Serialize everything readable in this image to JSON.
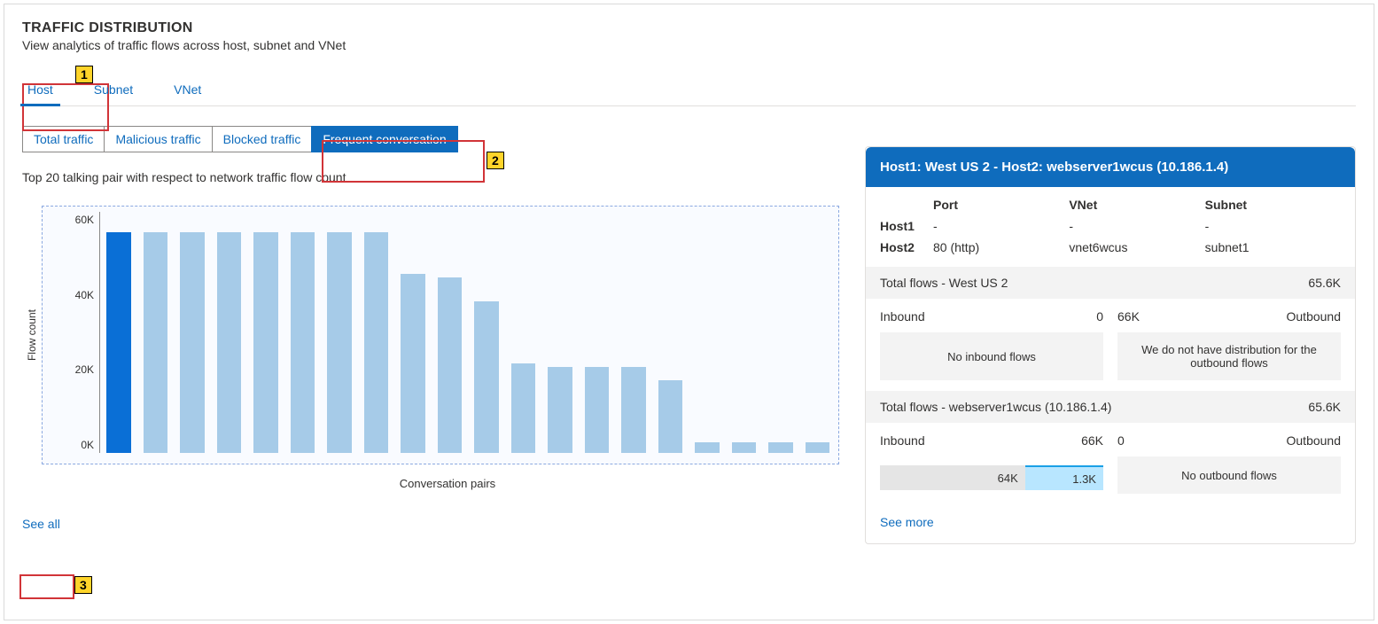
{
  "header": {
    "title": "TRAFFIC DISTRIBUTION",
    "subtitle": "View analytics of traffic flows across host, subnet and VNet"
  },
  "tabs": {
    "items": [
      "Host",
      "Subnet",
      "VNet"
    ],
    "active": "Host"
  },
  "pills": {
    "items": [
      "Total traffic",
      "Malicious traffic",
      "Blocked traffic",
      "Frequent conversation"
    ],
    "active": "Frequent conversation"
  },
  "chart_caption": "Top 20 talking pair with respect to network traffic flow count",
  "chart_xlabel": "Conversation pairs",
  "chart_ylabel": "Flow count",
  "see_all_label": "See all",
  "annotations": {
    "n1": "1",
    "n2": "2",
    "n3": "3"
  },
  "chart_data": {
    "type": "bar",
    "title": "Top 20 talking pair with respect to network traffic flow count",
    "xlabel": "Conversation pairs",
    "ylabel": "Flow count",
    "yticks": [
      "60K",
      "40K",
      "20K",
      "0K"
    ],
    "ylim": [
      0,
      70000
    ],
    "selected_index": 0,
    "values": [
      64000,
      64000,
      64000,
      64000,
      64000,
      64000,
      64000,
      64000,
      52000,
      51000,
      44000,
      26000,
      25000,
      25000,
      25000,
      21000,
      3000,
      3000,
      3000,
      3000
    ]
  },
  "detail": {
    "header": "Host1: West US 2 - Host2: webserver1wcus (10.186.1.4)",
    "cols": {
      "port": "Port",
      "vnet": "VNet",
      "subnet": "Subnet"
    },
    "rows": {
      "host1": {
        "label": "Host1",
        "port": "-",
        "vnet": "-",
        "subnet": "-"
      },
      "host2": {
        "label": "Host2",
        "port": "80 (http)",
        "vnet": "vnet6wcus",
        "subnet": "subnet1"
      }
    },
    "section1": {
      "title": "Total flows - West US 2",
      "total": "65.6K",
      "inbound_label": "Inbound",
      "inbound_value": "0",
      "outbound_label": "Outbound",
      "outbound_value": "66K",
      "left_msg": "No inbound flows",
      "right_msg": "We do not have distribution for the outbound flows"
    },
    "section2": {
      "title": "Total flows - webserver1wcus (10.186.1.4)",
      "total": "65.6K",
      "inbound_label": "Inbound",
      "inbound_value": "66K",
      "outbound_label": "Outbound",
      "outbound_value": "0",
      "split": {
        "a_label": "64K",
        "a_pct": 65,
        "b_label": "1.3K",
        "b_pct": 35
      },
      "right_msg": "No outbound flows"
    },
    "see_more": "See more"
  }
}
